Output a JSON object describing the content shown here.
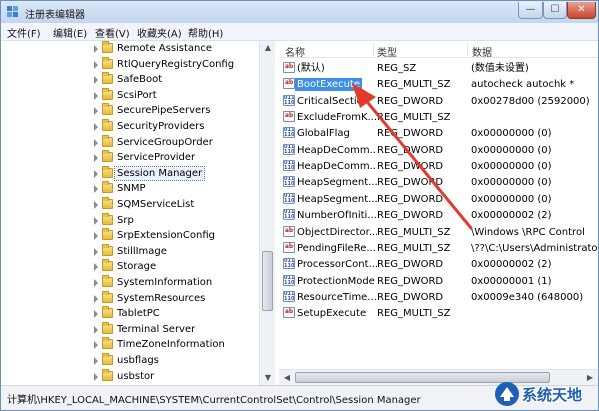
{
  "window": {
    "title": "注册表编辑器",
    "controls": {
      "minimize": "—",
      "maximize": "☐",
      "close": "✕"
    }
  },
  "menu": [
    "文件(F)",
    "编辑(E)",
    "查看(V)",
    "收藏夹(A)",
    "帮助(H)"
  ],
  "tree": {
    "items": [
      {
        "label": "Remote Assistance"
      },
      {
        "label": "RtlQueryRegistryConfig"
      },
      {
        "label": "SafeBoot"
      },
      {
        "label": "ScsiPort"
      },
      {
        "label": "SecurePipeServers"
      },
      {
        "label": "SecurityProviders"
      },
      {
        "label": "ServiceGroupOrder"
      },
      {
        "label": "ServiceProvider"
      },
      {
        "label": "Session Manager",
        "selected": true
      },
      {
        "label": "SNMP"
      },
      {
        "label": "SQMServiceList"
      },
      {
        "label": "Srp"
      },
      {
        "label": "SrpExtensionConfig"
      },
      {
        "label": "StillImage"
      },
      {
        "label": "Storage"
      },
      {
        "label": "SystemInformation"
      },
      {
        "label": "SystemResources"
      },
      {
        "label": "TabletPC"
      },
      {
        "label": "Terminal Server"
      },
      {
        "label": "TimeZoneInformation"
      },
      {
        "label": "usbflags"
      },
      {
        "label": "usbstor"
      }
    ]
  },
  "list": {
    "columns": [
      "名称",
      "类型",
      "数据"
    ],
    "rows": [
      {
        "icon": "string-value-icon",
        "name": "(默认)",
        "type": "REG_SZ",
        "data": "(数值未设置)"
      },
      {
        "icon": "string-value-icon",
        "name": "BootExecute",
        "type": "REG_MULTI_SZ",
        "data": "autocheck autochk *",
        "selected": true
      },
      {
        "icon": "binary-value-icon",
        "name": "CriticalSection",
        "type": "REG_DWORD",
        "data": "0x00278d00 (2592000)"
      },
      {
        "icon": "string-value-icon",
        "name": "ExcludeFromK...",
        "type": "REG_MULTI_SZ",
        "data": ""
      },
      {
        "icon": "binary-value-icon",
        "name": "GlobalFlag",
        "type": "REG_DWORD",
        "data": "0x00000000 (0)"
      },
      {
        "icon": "binary-value-icon",
        "name": "HeapDeComm...",
        "type": "REG_DWORD",
        "data": "0x00000000 (0)"
      },
      {
        "icon": "binary-value-icon",
        "name": "HeapDeComm...",
        "type": "REG_DWORD",
        "data": "0x00000000 (0)"
      },
      {
        "icon": "binary-value-icon",
        "name": "HeapSegment...",
        "type": "REG_DWORD",
        "data": "0x00000000 (0)"
      },
      {
        "icon": "binary-value-icon",
        "name": "HeapSegment...",
        "type": "REG_DWORD",
        "data": "0x00000000 (0)"
      },
      {
        "icon": "binary-value-icon",
        "name": "NumberOfIniti...",
        "type": "REG_DWORD",
        "data": "0x00000002 (2)"
      },
      {
        "icon": "string-value-icon",
        "name": "ObjectDirector...",
        "type": "REG_MULTI_SZ",
        "data": "\\Windows \\RPC Control"
      },
      {
        "icon": "string-value-icon",
        "name": "PendingFileRe...",
        "type": "REG_MULTI_SZ",
        "data": "\\??\\C:\\Users\\Administrator"
      },
      {
        "icon": "binary-value-icon",
        "name": "ProcessorCont...",
        "type": "REG_DWORD",
        "data": "0x00000002 (2)"
      },
      {
        "icon": "binary-value-icon",
        "name": "ProtectionMode",
        "type": "REG_DWORD",
        "data": "0x00000001 (1)"
      },
      {
        "icon": "binary-value-icon",
        "name": "ResourceTime...",
        "type": "REG_DWORD",
        "data": "0x0009e340 (648000)"
      },
      {
        "icon": "string-value-icon",
        "name": "SetupExecute",
        "type": "REG_MULTI_SZ",
        "data": ""
      }
    ]
  },
  "status": {
    "path": "计算机\\HKEY_LOCAL_MACHINE\\SYSTEM\\CurrentControlSet\\Control\\Session Manager"
  },
  "watermark": {
    "text": "系统天地"
  },
  "colors": {
    "accent": "#3d8ee8",
    "annotation": "#e23b2e",
    "watermark": "#1f5fb5"
  }
}
